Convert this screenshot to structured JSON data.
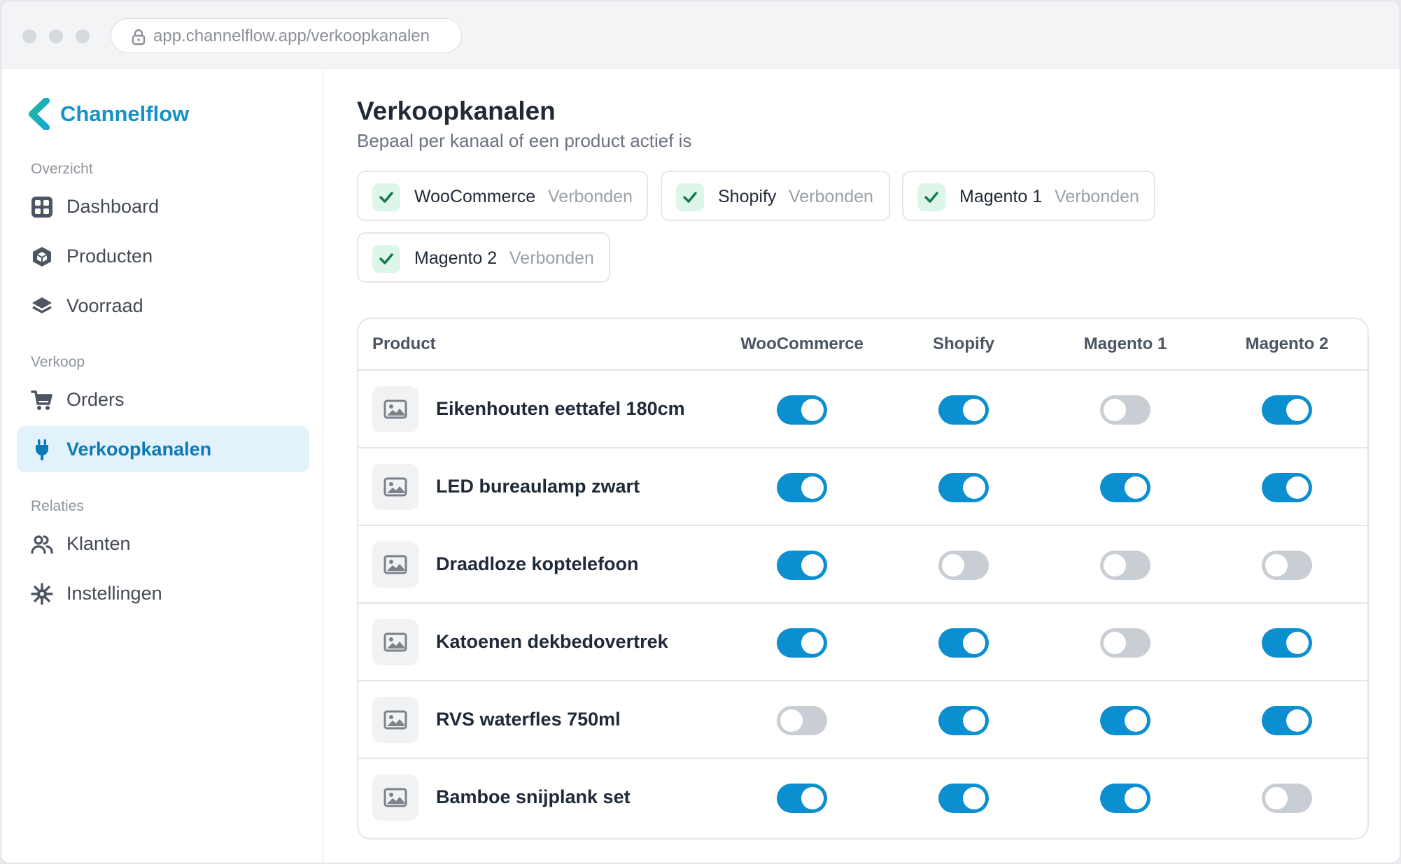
{
  "browser": {
    "url": "app.channelflow.app/verkoopkanalen"
  },
  "app": {
    "name": "Channelflow"
  },
  "sidebar": {
    "sections": [
      {
        "label": "Overzicht",
        "items": [
          {
            "label": "Dashboard",
            "icon": "dashboard-icon"
          },
          {
            "label": "Producten",
            "icon": "box-icon"
          },
          {
            "label": "Voorraad",
            "icon": "layers-icon"
          }
        ]
      },
      {
        "label": "Verkoop",
        "items": [
          {
            "label": "Orders",
            "icon": "cart-icon"
          },
          {
            "label": "Verkoopkanalen",
            "icon": "plug-icon",
            "active": true
          }
        ]
      },
      {
        "label": "Relaties",
        "items": [
          {
            "label": "Klanten",
            "icon": "users-icon"
          },
          {
            "label": "Instellingen",
            "icon": "settings-icon"
          }
        ]
      }
    ]
  },
  "page": {
    "title": "Verkoopkanalen",
    "subtitle": "Bepaal per kanaal of een product actief is"
  },
  "channels": [
    {
      "name": "WooCommerce",
      "status": "Verbonden"
    },
    {
      "name": "Shopify",
      "status": "Verbonden"
    },
    {
      "name": "Magento 1",
      "status": "Verbonden"
    },
    {
      "name": "Magento 2",
      "status": "Verbonden"
    }
  ],
  "table": {
    "headers": [
      "Product",
      "WooCommerce",
      "Shopify",
      "Magento 1",
      "Magento 2"
    ],
    "rows": [
      {
        "product": "Eikenhouten eettafel 180cm",
        "toggles": [
          true,
          true,
          false,
          true
        ]
      },
      {
        "product": "LED bureaulamp zwart",
        "toggles": [
          true,
          true,
          true,
          true
        ]
      },
      {
        "product": "Draadloze koptelefoon",
        "toggles": [
          true,
          false,
          false,
          false
        ]
      },
      {
        "product": "Katoenen dekbedovertrek",
        "toggles": [
          true,
          true,
          false,
          true
        ]
      },
      {
        "product": "RVS waterfles 750ml",
        "toggles": [
          false,
          true,
          true,
          true
        ]
      },
      {
        "product": "Bamboe snijplank set",
        "toggles": [
          true,
          true,
          true,
          false
        ]
      }
    ]
  },
  "colors": {
    "accent": "#0c8fd0",
    "brand": "#1393c9",
    "toggle_off": "#c9ced4",
    "active_bg": "#e1f2fa"
  }
}
